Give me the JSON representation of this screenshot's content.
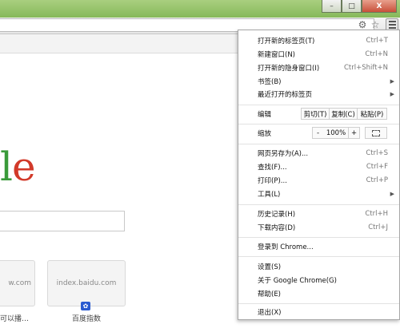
{
  "window": {
    "minimize_icon": "minimize-icon",
    "maximize_icon": "maximize-icon",
    "close_icon": "close-icon",
    "close_label": "X",
    "theme_color": "#8fbf62"
  },
  "toolbar": {
    "extension_icon": "extension-icon",
    "star_icon": "star-icon",
    "menu_icon": "menu-icon"
  },
  "page": {
    "logo_partial": "le",
    "tiles": [
      {
        "url": "w.com",
        "caption": "可以播…"
      },
      {
        "url": "index.baidu.com",
        "caption": "百度指数",
        "icon": "baidu-paw-icon"
      }
    ]
  },
  "menu": {
    "items": [
      {
        "label": "打开新的标签页(T)",
        "shortcut": "Ctrl+T"
      },
      {
        "label": "新建窗口(N)",
        "shortcut": "Ctrl+N"
      },
      {
        "label": "打开新的隐身窗口(I)",
        "shortcut": "Ctrl+Shift+N"
      },
      {
        "label": "书签(B)",
        "submenu": true
      },
      {
        "label": "最近打开的标签页",
        "submenu": true
      }
    ],
    "edit": {
      "label": "编辑",
      "cut": "剪切(T)",
      "copy": "复制(C)",
      "paste": "粘贴(P)"
    },
    "zoom": {
      "label": "缩放",
      "minus": "-",
      "value": "100%",
      "plus": "+",
      "fullscreen_icon": "fullscreen-icon"
    },
    "items2": [
      {
        "label": "网页另存为(A)...",
        "shortcut": "Ctrl+S"
      },
      {
        "label": "查找(F)...",
        "shortcut": "Ctrl+F"
      },
      {
        "label": "打印(P)...",
        "shortcut": "Ctrl+P"
      },
      {
        "label": "工具(L)",
        "submenu": true
      }
    ],
    "items3": [
      {
        "label": "历史记录(H)",
        "shortcut": "Ctrl+H"
      },
      {
        "label": "下载内容(D)",
        "shortcut": "Ctrl+J"
      }
    ],
    "signin": "登录到 Chrome...",
    "items4": [
      {
        "label": "设置(S)"
      },
      {
        "label": "关于 Google Chrome(G)"
      },
      {
        "label": "帮助(E)"
      }
    ],
    "exit": "退出(X)"
  }
}
